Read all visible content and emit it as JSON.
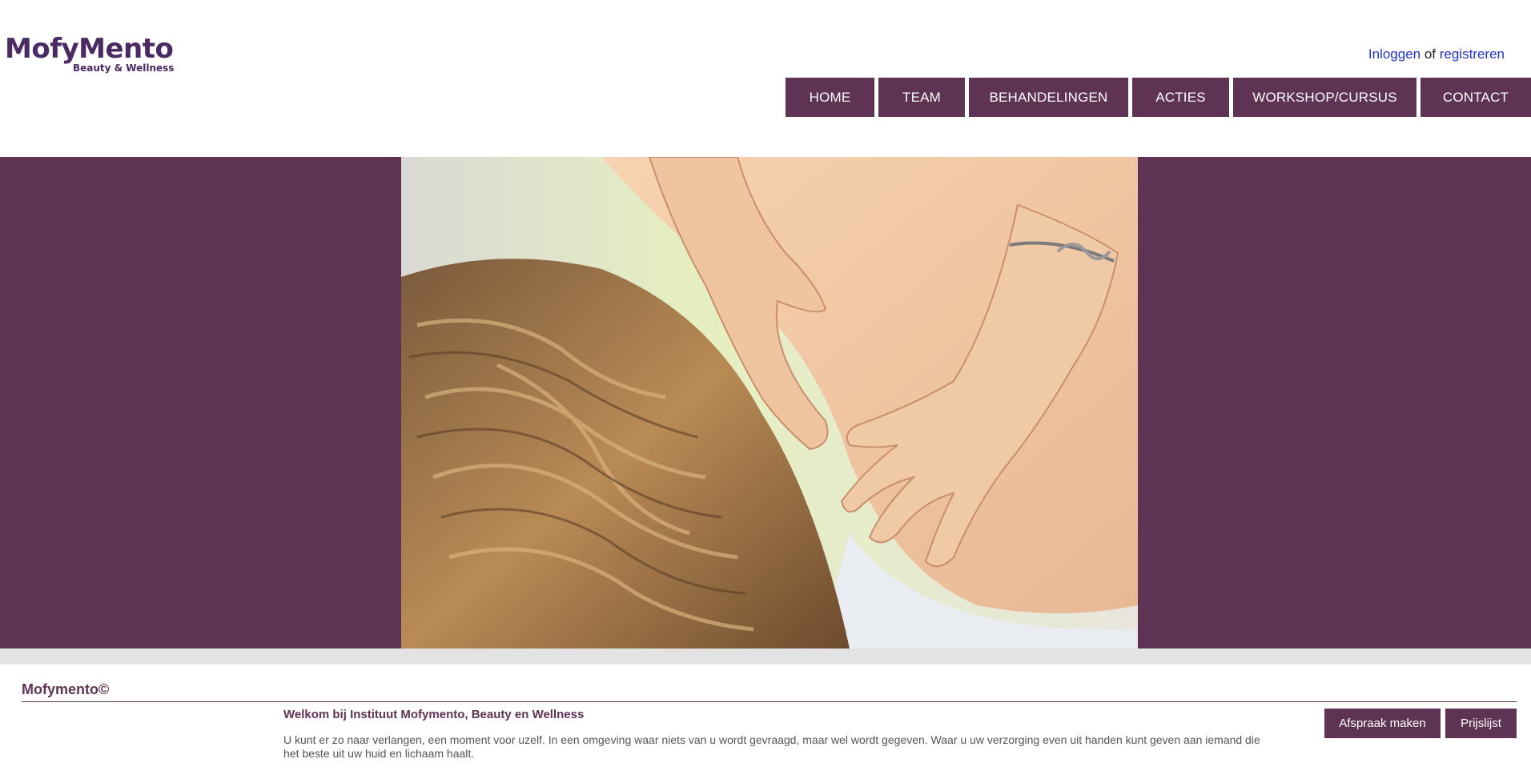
{
  "brand": {
    "logo_main": "MofyMento",
    "logo_sub": "Beauty & Wellness"
  },
  "auth": {
    "login_label": "Inloggen",
    "separator": " of ",
    "register_label": "registreren"
  },
  "nav": {
    "items": [
      {
        "label": "HOME"
      },
      {
        "label": "TEAM"
      },
      {
        "label": "BEHANDELINGEN"
      },
      {
        "label": "ACTIES"
      },
      {
        "label": "WORKSHOP/CURSUS"
      },
      {
        "label": "CONTACT"
      }
    ]
  },
  "hero": {
    "image_subject": "massage-photo"
  },
  "content": {
    "brand_title": "Mofymento©",
    "welcome_title": "Welkom bij Instituut Mofymento, Beauty en Wellness",
    "welcome_text": "U kunt er zo naar verlangen, een moment voor uzelf. In een omgeving waar niets van u wordt gevraagd, maar wel wordt gegeven. Waar u uw verzorging even uit handen kunt geven aan iemand die het beste uit uw huid en lichaam haalt.",
    "buttons": {
      "appointment_label": "Afspraak maken",
      "pricelist_label": "Prijslijst"
    }
  },
  "colors": {
    "primary": "#5f3354",
    "logo": "#4b2a63",
    "link": "#2233cc",
    "band": "#e3e3e3"
  }
}
